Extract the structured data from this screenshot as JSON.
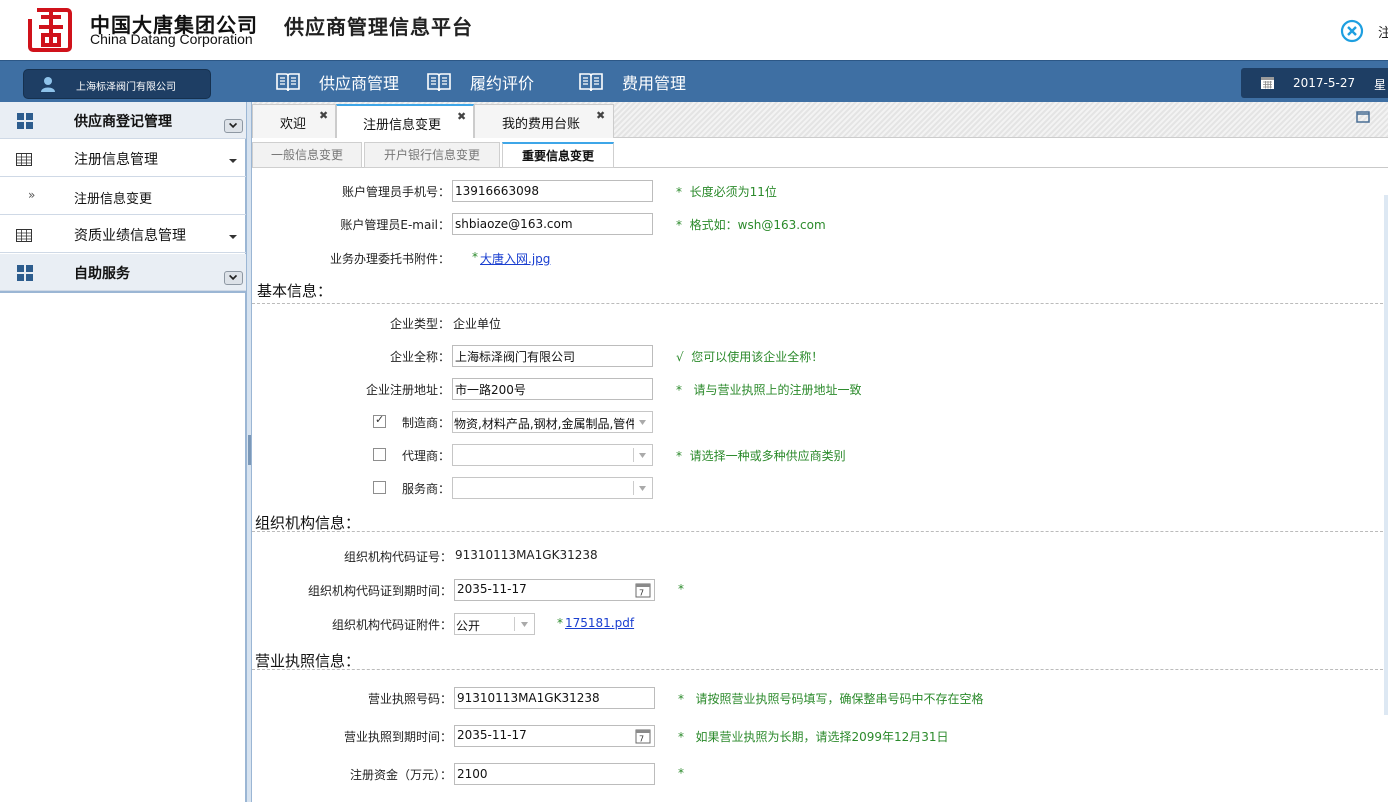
{
  "header": {
    "logo_cn": "中国大唐集团公司",
    "logo_en": "China Datang Corporation",
    "platform_title": "供应商管理信息平台",
    "logout_label": "注"
  },
  "nav": {
    "company_name": "上海标泽阀门有限公司",
    "items": [
      {
        "label": "供应商管理"
      },
      {
        "label": "履约评价"
      },
      {
        "label": "费用管理"
      }
    ],
    "date": "2017-5-27",
    "weekday": "星"
  },
  "sidebar": {
    "groups": [
      {
        "label": "供应商登记管理"
      },
      {
        "label": "注册信息管理"
      },
      {
        "label": "注册信息变更"
      },
      {
        "label": "资质业绩信息管理"
      },
      {
        "label": "自助服务"
      }
    ]
  },
  "tabs": [
    {
      "label": "欢迎",
      "active": false
    },
    {
      "label": "注册信息变更",
      "active": true
    },
    {
      "label": "我的费用台账",
      "active": false
    }
  ],
  "subtabs": [
    {
      "label": "一般信息变更",
      "active": false
    },
    {
      "label": "开户银行信息变更",
      "active": false
    },
    {
      "label": "重要信息变更",
      "active": true
    }
  ],
  "form": {
    "admin_phone": {
      "label": "账户管理员手机号：",
      "value": "13916663098",
      "hint": "长度必须为11位"
    },
    "admin_email": {
      "label": "账户管理员E-mail：",
      "value": "shbiaoze@163.com",
      "hint": "格式如：wsh@163.com"
    },
    "authorization": {
      "label": "业务办理委托书附件：",
      "file": "大唐入网.jpg"
    },
    "basic_section": "基本信息：",
    "company_type": {
      "label": "企业类型：",
      "value": "企业单位"
    },
    "company_name": {
      "label": "企业全称：",
      "value": "上海标泽阀门有限公司",
      "hint": "您可以使用该企业全称！"
    },
    "reg_address": {
      "label": "企业注册地址：",
      "value": "市一路200号",
      "hint": "请与营业执照上的注册地址一致"
    },
    "manufacturer": {
      "label": "制造商：",
      "checked": true,
      "value": "物资,材料产品,钢材,金属制品,管件"
    },
    "agent": {
      "label": "代理商：",
      "checked": false,
      "value": "",
      "hint": "请选择一种或多种供应商类别"
    },
    "service": {
      "label": "服务商：",
      "checked": false,
      "value": ""
    },
    "org_section": "组织机构信息：",
    "org_code": {
      "label": "组织机构代码证号：",
      "value": "91310113MA1GK31238"
    },
    "org_expiry": {
      "label": "组织机构代码证到期时间：",
      "value": "2035-11-17"
    },
    "org_attach": {
      "label": "组织机构代码证附件：",
      "select": "公开",
      "file": "175181.pdf"
    },
    "license_section": "营业执照信息：",
    "license_no": {
      "label": "营业执照号码：",
      "value": "91310113MA1GK31238",
      "hint": "请按照营业执照号码填写，确保整串号码中不存在空格"
    },
    "license_expiry": {
      "label": "营业执照到期时间：",
      "value": "2035-11-17",
      "hint": "如果营业执照为长期，请选择2099年12月31日"
    },
    "reg_capital": {
      "label": "注册资金（万元）：",
      "value": "2100"
    }
  },
  "colors": {
    "nav_blue": "#3e6fa3",
    "hint_green": "#2b8a2b",
    "link_blue": "#1a3fd0",
    "tab_accent": "#3ea6e8",
    "logo_red": "#d0121b"
  }
}
